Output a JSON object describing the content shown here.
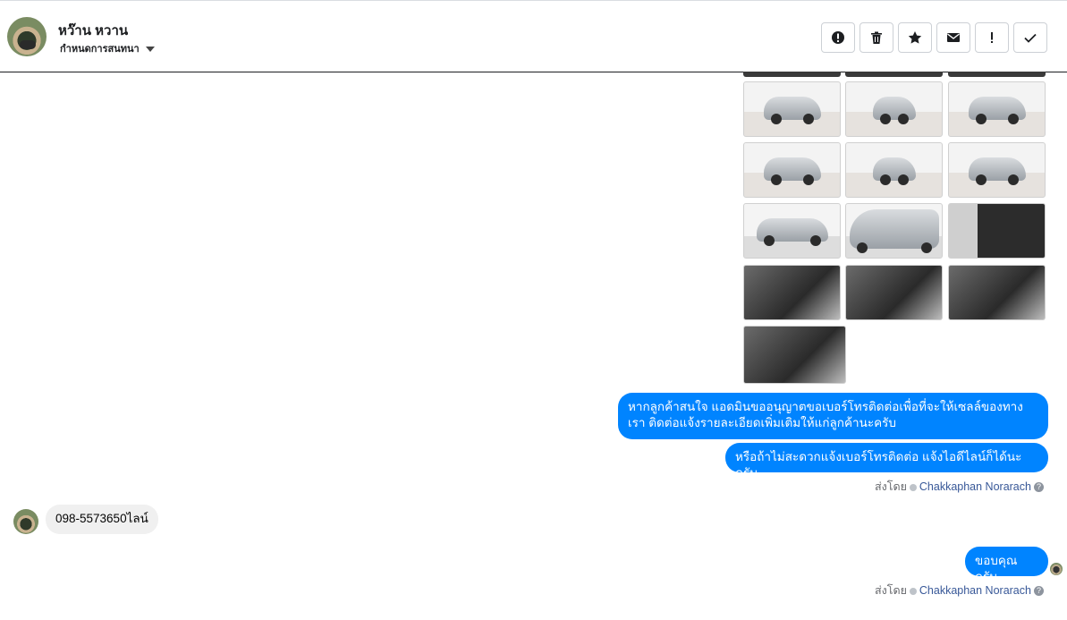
{
  "header": {
    "contact_name": "หว๊าน หวาน",
    "conversation_setting": "กำหนดการสนทนา",
    "actions": [
      {
        "name": "report-spam-button",
        "icon": "alert-circle-icon"
      },
      {
        "name": "delete-button",
        "icon": "trash-icon"
      },
      {
        "name": "star-button",
        "icon": "star-icon"
      },
      {
        "name": "mark-unread-button",
        "icon": "envelope-icon"
      },
      {
        "name": "follow-up-button",
        "icon": "exclamation-icon"
      },
      {
        "name": "mark-done-button",
        "icon": "check-icon"
      }
    ]
  },
  "messages": {
    "outgoing_1": "หากลูกค้าสนใจ แอดมินขออนุญาตขอเบอร์โทรติดต่อเพื่อที่จะให้เซลล์ของทางเรา ติดต่อแจ้งรายละเอียดเพิ่มเติมให้แก่ลูกค้านะครับ",
    "outgoing_2": "หรือถ้าไม่สะดวกแจ้งเบอร์โทรติดต่อ แจ้งไอดีไลน์ก็ได้นะครับ",
    "incoming_1": "098-5573650ไลน์",
    "outgoing_3": "ขอบคุณครับ",
    "sent_by_prefix": "ส่งโดย",
    "sent_by_name": "Chakkaphan Norarach"
  },
  "colors": {
    "outgoing_bubble": "#0084ff",
    "incoming_bubble": "#f0f0f0",
    "link": "#385898"
  }
}
